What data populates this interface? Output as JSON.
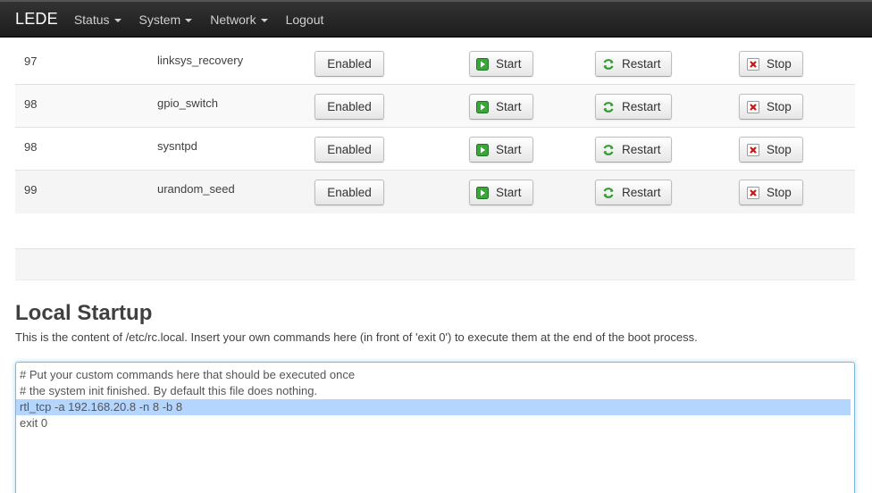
{
  "navbar": {
    "brand": "LEDE",
    "items": [
      {
        "label": "Status",
        "has_dropdown": true
      },
      {
        "label": "System",
        "has_dropdown": true
      },
      {
        "label": "Network",
        "has_dropdown": true
      },
      {
        "label": "Logout",
        "has_dropdown": false
      }
    ]
  },
  "startup_table": {
    "rows": [
      {
        "priority": "97",
        "name": "linksys_recovery",
        "enabled_label": "Enabled",
        "start_label": "Start",
        "restart_label": "Restart",
        "stop_label": "Stop"
      },
      {
        "priority": "98",
        "name": "gpio_switch",
        "enabled_label": "Enabled",
        "start_label": "Start",
        "restart_label": "Restart",
        "stop_label": "Stop"
      },
      {
        "priority": "98",
        "name": "sysntpd",
        "enabled_label": "Enabled",
        "start_label": "Start",
        "restart_label": "Restart",
        "stop_label": "Stop"
      },
      {
        "priority": "99",
        "name": "urandom_seed",
        "enabled_label": "Enabled",
        "start_label": "Start",
        "restart_label": "Restart",
        "stop_label": "Stop"
      }
    ]
  },
  "local_startup": {
    "title": "Local Startup",
    "description": "This is the content of /etc/rc.local. Insert your own commands here (in front of 'exit 0') to execute them at the end of the boot process.",
    "lines": [
      "# Put your custom commands here that should be executed once",
      "# the system init finished. By default this file does nothing.",
      "rtl_tcp -a 192.168.20.8 -n 8 -b 8",
      "exit 0"
    ],
    "selected_line": 2
  },
  "colors": {
    "navbar_bg": "#222222",
    "start_icon": "#3aa53a",
    "restart_icon": "#2e9e2e",
    "stop_icon": "#cc1111",
    "selection": "#b4d5fe",
    "focus_border": "#7ab8e0"
  },
  "icons": {
    "start": "start-icon",
    "restart": "restart-icon",
    "stop": "stop-icon",
    "dropdown": "caret-down-icon"
  }
}
